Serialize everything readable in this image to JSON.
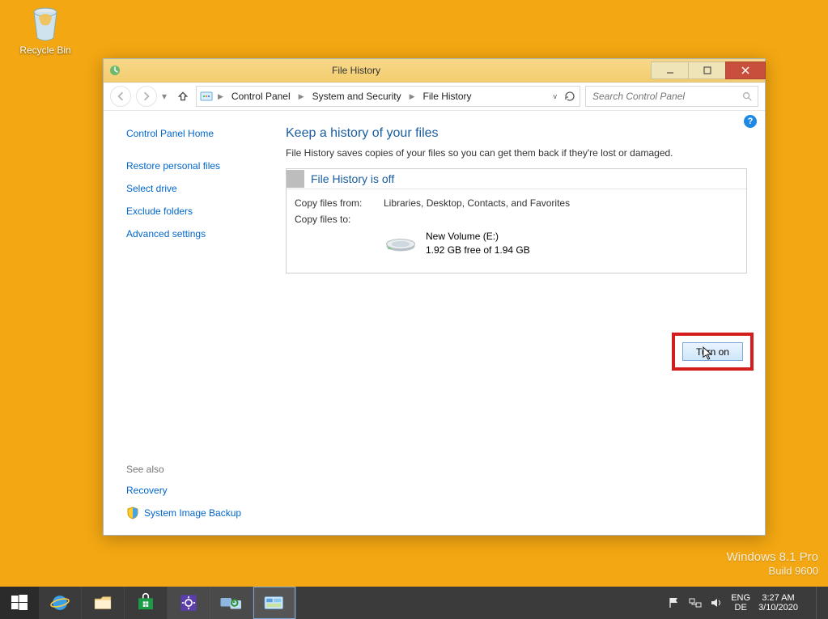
{
  "desktop": {
    "recycle_bin": "Recycle Bin"
  },
  "window": {
    "title": "File History",
    "controls": {
      "min": "Minimize",
      "max": "Maximize",
      "close": "Close"
    }
  },
  "addr": {
    "crumbs": [
      "Control Panel",
      "System and Security",
      "File History"
    ],
    "refresh": "Refresh"
  },
  "search": {
    "placeholder": "Search Control Panel"
  },
  "sidebar": {
    "home": "Control Panel Home",
    "links": [
      "Restore personal files",
      "Select drive",
      "Exclude folders",
      "Advanced settings"
    ],
    "see_also_label": "See also",
    "see_also": [
      "Recovery",
      "System Image Backup"
    ]
  },
  "content": {
    "heading": "Keep a history of your files",
    "desc": "File History saves copies of your files so you can get them back if they're lost or damaged.",
    "status_title": "File History is off",
    "from_label": "Copy files from:",
    "from_value": "Libraries, Desktop, Contacts, and Favorites",
    "to_label": "Copy files to:",
    "drive_name": "New Volume (E:)",
    "drive_free": "1.92 GB free of 1.94 GB",
    "turn_on": "Turn on",
    "help": "?"
  },
  "watermark": {
    "line1": "Windows 8.1 Pro",
    "line2": "Build 9600"
  },
  "tray": {
    "lang1": "ENG",
    "lang2": "DE",
    "time": "3:27 AM",
    "date": "3/10/2020"
  }
}
